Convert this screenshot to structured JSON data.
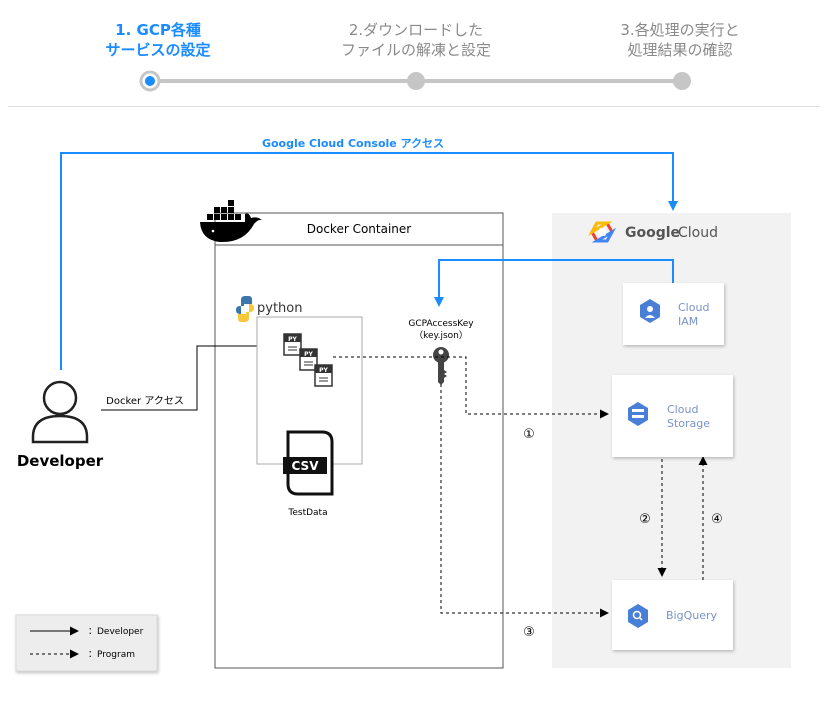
{
  "stepper": {
    "steps": [
      {
        "label": "1. GCP各種\nサービスの設定"
      },
      {
        "label": "2.ダウンロードした\nファイルの解凍と設定"
      },
      {
        "label": "3.各処理の実行と\n処理結果の確認"
      }
    ]
  },
  "diagram": {
    "console_access": "Google Cloud Console アクセス",
    "docker_access": "Docker アクセス",
    "developer": "Developer",
    "docker_container": "Docker Container",
    "python": "python",
    "py_file": "PY",
    "gcp_key_line1": "GCPAccessKey",
    "gcp_key_line2": "（key.json）",
    "csv": "CSV",
    "testdata": "TestData",
    "google": "Google",
    "cloud": "Cloud",
    "iam": "Cloud\nIAM",
    "storage": "Cloud\nStorage",
    "bigquery": "BigQuery",
    "step1": "①",
    "step2": "②",
    "step3": "③",
    "step4": "④"
  },
  "legend": {
    "developer": "：Developer",
    "program": "：Program"
  },
  "colors": {
    "accent": "#1a8cff",
    "inactive": "#bdbdbd",
    "gcp_blue": "#4a7fd8",
    "gcp_panel": "#f2f2f2"
  }
}
